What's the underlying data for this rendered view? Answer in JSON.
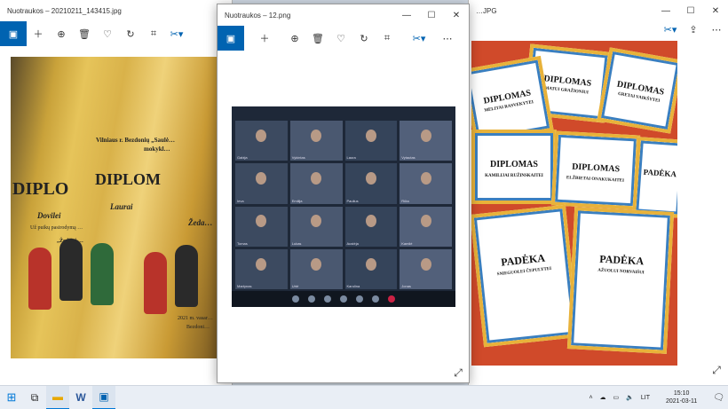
{
  "windows": {
    "left": {
      "title": "Nuotraukos – 20210211_143415.jpg"
    },
    "center": {
      "title": "Nuotraukos – 12.png"
    },
    "right": {
      "title": "…JPG"
    }
  },
  "toolbar_icons": [
    "picture-icon",
    "plus-icon",
    "zoom-icon",
    "delete-icon",
    "heart-icon",
    "rotate-icon",
    "crop-icon",
    "edit-icon",
    "more-icon"
  ],
  "left_photo": {
    "school_text": "Vilniaus r. Bezdonių „Saulė…",
    "school_text2": "mokykl…",
    "diploma_word": "DIPLO",
    "diploma_word2": "DIPLOM",
    "names": [
      "Dovilei",
      "Laurai",
      "Žeda…"
    ],
    "line1": "Už puikų pasirodymą …",
    "line2": "„Žodžiai …",
    "footer": "2021 m. vasar…",
    "footer2": "Bezdoni…"
  },
  "right_photo": {
    "cert_titles": [
      "DIPLOMAS",
      "DIPLOMAS",
      "DIPLOMAS",
      "DIPLOMAS",
      "PADĖKA",
      "PADĖKA",
      "PADĖKA"
    ],
    "names": [
      "MATUI GRAŽIONIUI",
      "MELITAI RASVEKYTEI",
      "GRETAI VAIKŠYTEI",
      "KAMILIJAI RUŽINSKAITEI",
      "ELŽBIETAI ONAKUKAITEI",
      "SNIEGUOLEI ČEPULYTEI",
      "AŽUOLUI NORVAIŠUI"
    ]
  },
  "zoom": {
    "header_text": "…",
    "participants": [
      "Gabija",
      "Vykintas",
      "Laura",
      "Vytautas",
      "Ieva",
      "Emilija",
      "Paulius",
      "Rūta",
      "Tomas",
      "Lukas",
      "Austėja",
      "Kamilė",
      "Martynas",
      "Urtė",
      "Karolina",
      "Jonas"
    ]
  },
  "taskbar": {
    "language": "LIT",
    "time": "15:10",
    "date": "2021-03-11"
  },
  "colors": {
    "accent": "#0063b1",
    "taskbar": "#e9eef5"
  }
}
